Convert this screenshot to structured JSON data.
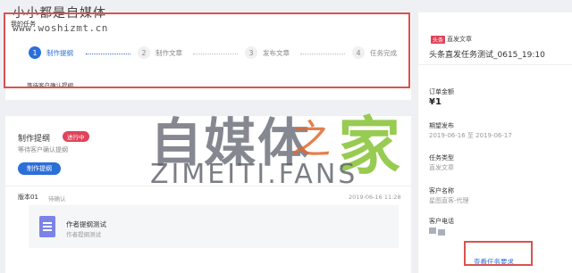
{
  "watermark": {
    "top_text": "小小都是自媒体",
    "url": "www.woshizmt.cn",
    "big_main": "自媒体",
    "big_zhi": "之",
    "big_jia": "家",
    "big_sub": "ZIMEITI.FANS"
  },
  "task": {
    "label": "我的任务",
    "await_note": "等待客户确认提纲",
    "steps": [
      {
        "num": "1",
        "label": "制作提纲",
        "state": "active"
      },
      {
        "num": "2",
        "label": "制作文章",
        "state": "idle"
      },
      {
        "num": "3",
        "label": "发布文章",
        "state": "idle"
      },
      {
        "num": "4",
        "label": "任务完成",
        "state": "idle"
      }
    ]
  },
  "production": {
    "title": "制作提纲",
    "badge": "进行中",
    "subtitle": "等待客户确认提纲",
    "button": "制作提纲",
    "version_label": "版本01",
    "version_status": "待确认",
    "version_time": "2019-06-16 11:28",
    "doc_title": "作者提纲测试",
    "doc_sub": "作者提纲测试"
  },
  "sidebar": {
    "tag": "头条",
    "tag_text": "直发文章",
    "title": "头条直发任务测试_0615_19:10",
    "order_amount_label": "订单金额",
    "order_amount_value": "¥1",
    "expected_label": "期望发布",
    "expected_value": "2019-06-16 至 2019-06-17",
    "type_label": "任务类型",
    "type_value": "直发文章",
    "client_label": "客户名称",
    "client_value": "星图直客-代理",
    "phone_label": "客户电话",
    "link": "查看任务要求"
  },
  "colors": {
    "accent": "#2d6fd8",
    "badge": "#e0435a",
    "highlight_frame": "#d9534f"
  }
}
